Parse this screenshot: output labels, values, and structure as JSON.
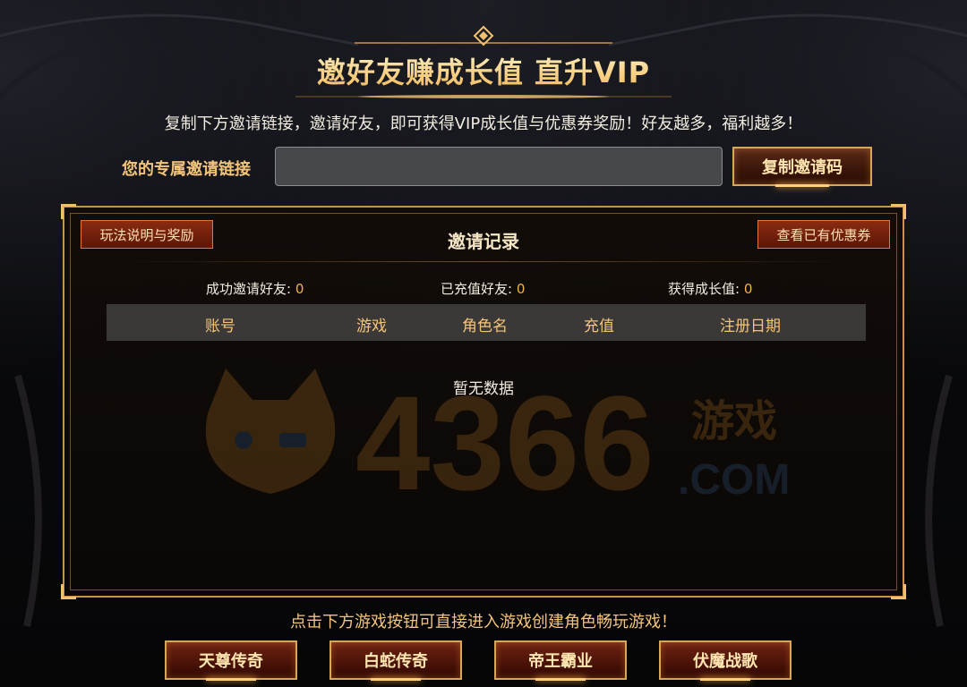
{
  "header": {
    "title": "邀好友赚成长值 直升VIP",
    "subtitle": "复制下方邀请链接，邀请好友，即可获得VIP成长值与优惠券奖励！好友越多，福利越多！"
  },
  "invite_link": {
    "label": "您的专属邀请链接",
    "value": "",
    "copy_label": "复制邀请码"
  },
  "records": {
    "title": "邀请记录",
    "rules_label": "玩法说明与奖励",
    "coupons_label": "查看已有优惠券",
    "stats": [
      {
        "label": "成功邀请好友:",
        "value": "0"
      },
      {
        "label": "已充值好友:",
        "value": "0"
      },
      {
        "label": "获得成长值:",
        "value": "0"
      }
    ],
    "columns": [
      "账号",
      "游戏",
      "角色名",
      "充值",
      "注册日期"
    ],
    "rows": [],
    "empty_text": "暂无数据"
  },
  "watermark": {
    "number": "4366",
    "cn": "游戏",
    "domain": ".COM"
  },
  "footer": {
    "tip": "点击下方游戏按钮可直接进入游戏创建角色畅玩游戏！",
    "games": [
      "天尊传奇",
      "白蛇传奇",
      "帝王霸业",
      "伏魔战歌"
    ]
  },
  "colors": {
    "gold": "#f3c47a",
    "accent_number": "#f1b24a",
    "button_red": "#8a2b12",
    "border_gold": "#c9914a"
  }
}
